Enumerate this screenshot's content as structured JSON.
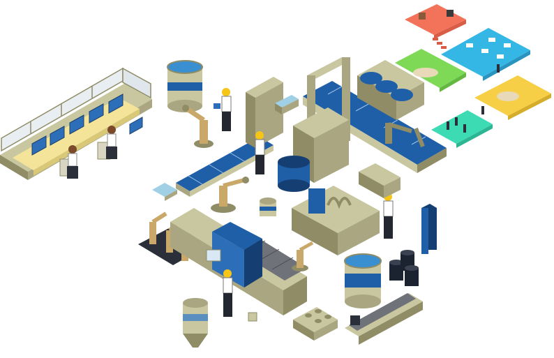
{
  "scene": {
    "style": "isometric illustration",
    "background_color": "#ffffff",
    "colors": {
      "olive": "#c9c7a0",
      "olive_dark": "#8f8c66",
      "olive_shade": "#a9a681",
      "conveyor_blue": "#1f5fa8",
      "conveyor_blue_dark": "#153f73",
      "monitor_blue": "#2c6fb8",
      "floor_red": "#f2735a",
      "floor_cyan": "#35b7e6",
      "floor_green": "#7ed957",
      "floor_yellow": "#f7cf46",
      "floor_teal": "#3ddbb3",
      "desk_yellow": "#f4e49a",
      "helmet": "#f5c518",
      "barrel": "#1b2230",
      "silo_top": "#3a8fd0"
    },
    "icons": [
      "control-room-icon",
      "robotic-arm-icon",
      "conveyor-belt-icon",
      "factory-worker-icon",
      "storage-tank-icon",
      "oil-barrel-icon",
      "office-floor-icon",
      "hopper-silo-icon"
    ]
  }
}
